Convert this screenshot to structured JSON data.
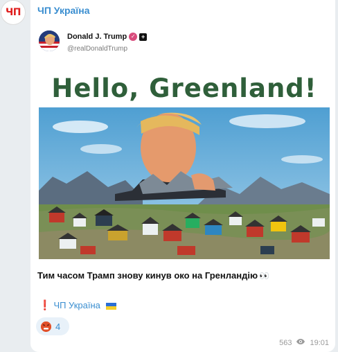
{
  "channel": {
    "avatar_text": "ЧП",
    "name": "ЧП Україна"
  },
  "embed": {
    "author_name": "Donald J. Trump",
    "author_handle": "@realDonaldTrump",
    "headline": "Hello, Greenland!"
  },
  "post": {
    "caption": "Тим часом Трамп знову кинув око на Гренландію",
    "caption_emoji": "👀",
    "promo_prefix": "❗",
    "promo_link": "ЧП Україна"
  },
  "reaction": {
    "emoji_name": "enraged-face",
    "count": "4"
  },
  "meta": {
    "views": "563",
    "time": "19:01",
    "icon": "eye-icon"
  },
  "colors": {
    "accent": "#3a8ed0",
    "headline_green": "#2f5f3a",
    "background": "#e9edf0"
  }
}
